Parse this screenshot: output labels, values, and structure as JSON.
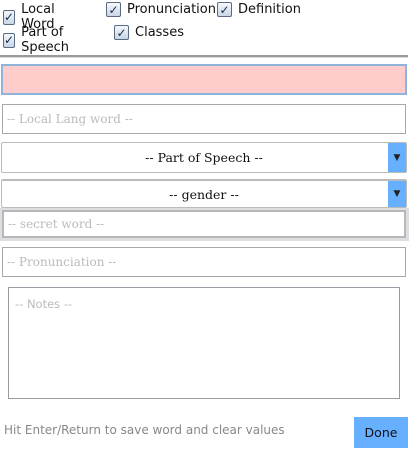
{
  "checkboxes": [
    {
      "label": "Local Word",
      "checked": true
    },
    {
      "label": "Pronunciation",
      "checked": true
    },
    {
      "label": "Definition",
      "checked": true
    },
    {
      "label": "Part of Speech",
      "checked": true
    },
    {
      "label": "Classes",
      "checked": true
    }
  ],
  "fields": {
    "conword": {
      "value": "",
      "placeholder": ""
    },
    "local_word": {
      "placeholder": "-- Local Lang word --"
    },
    "part_of_speech": {
      "selected": "-- Part of Speech --"
    },
    "gender": {
      "selected": "-- gender --"
    },
    "secret_word": {
      "placeholder": "-- secret word --"
    },
    "pronunciation": {
      "placeholder": "-- Pronunciation --"
    },
    "notes": {
      "placeholder": "-- Notes --"
    }
  },
  "hint": "Hit Enter/Return to save word and clear values",
  "done_label": "Done",
  "colors": {
    "accent": "#66b0ff",
    "error_field": "#ffcccc"
  },
  "icons": {
    "check": "checkmark-icon",
    "dropdown": "triangle-down-icon"
  }
}
